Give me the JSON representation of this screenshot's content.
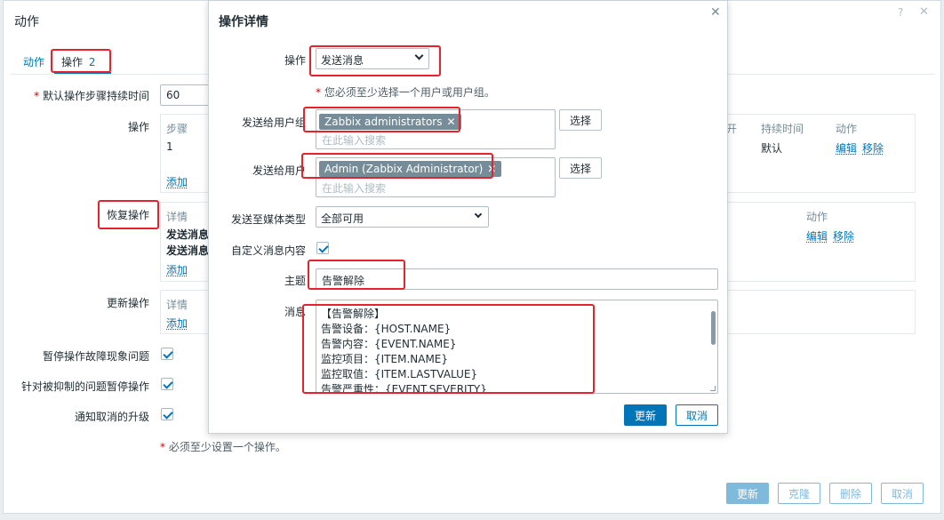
{
  "window": {
    "title": "动作",
    "help_icon": "?",
    "close_icon": "✕"
  },
  "tabs": [
    {
      "label": "动作"
    },
    {
      "label": "操作",
      "count": "2"
    }
  ],
  "form": {
    "default_step_label": "默认操作步骤持续时间",
    "default_step_value": "60",
    "operations_label": "操作",
    "operations_headers": [
      "步骤",
      "开",
      "持续时间",
      "动作"
    ],
    "operations_row": {
      "step": "1",
      "duration": "默认",
      "edit": "编辑",
      "remove": "移除"
    },
    "add_label": "添加",
    "recovery_label": "恢复操作",
    "recovery_header_details": "详情",
    "recovery_header_action": "动作",
    "recovery_rows": [
      "发送消息",
      "发送消息"
    ],
    "recovery_edit": "编辑",
    "recovery_remove": "移除",
    "update_ops_label": "更新操作",
    "update_ops_header": "详情",
    "pause_symptoms_label": "暂停操作故障现象问题",
    "pause_suppressed_label": "针对被抑制的问题暂停操作",
    "notify_cancel_label": "通知取消的升级",
    "required_note": "必须至少设置一个操作。",
    "buttons": {
      "update": "更新",
      "clone": "克隆",
      "delete": "删除",
      "cancel": "取消"
    }
  },
  "dialog": {
    "title": "操作详情",
    "operation_label": "操作",
    "operation_value": "发送消息",
    "hint": "您必须至少选择一个用户或用户组。",
    "user_groups_label": "发送给用户组",
    "user_group_chip": "Zabbix administrators",
    "users_label": "发送给用户",
    "user_chip": "Admin (Zabbix Administrator)",
    "search_placeholder": "在此输入搜索",
    "select_button": "选择",
    "media_label": "发送至媒体类型",
    "media_value": "全部可用",
    "custom_msg_label": "自定义消息内容",
    "subject_label": "主题",
    "subject_value": "告警解除",
    "message_label": "消息",
    "message_lines": [
      "【告警解除】",
      "告警设备：{HOST.NAME}",
      "告警内容：{EVENT.NAME}",
      "监控项目：{ITEM.NAME}",
      "监控取值：{ITEM.LASTVALUE}",
      "告警严重性：{EVENT.SEVERITY}"
    ],
    "update_button": "更新",
    "cancel_button": "取消"
  }
}
